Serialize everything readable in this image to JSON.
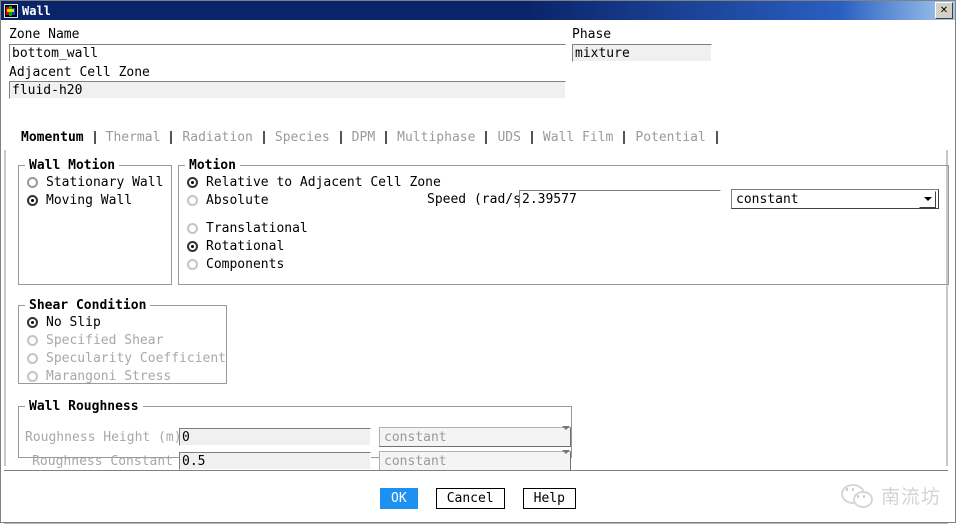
{
  "window": {
    "title": "Wall",
    "icon": "fluent-logo-icon",
    "close_label": "✕"
  },
  "form": {
    "zone_name_label": "Zone Name",
    "zone_name_value": "bottom_wall",
    "adjacent_cell_zone_label": "Adjacent Cell Zone",
    "adjacent_cell_zone_value": "fluid-h20",
    "phase_label": "Phase",
    "phase_value": "mixture"
  },
  "tabs": [
    {
      "label": "Momentum",
      "active": true
    },
    {
      "label": "Thermal",
      "active": false
    },
    {
      "label": "Radiation",
      "active": false
    },
    {
      "label": "Species",
      "active": false
    },
    {
      "label": "DPM",
      "active": false
    },
    {
      "label": "Multiphase",
      "active": false
    },
    {
      "label": "UDS",
      "active": false
    },
    {
      "label": "Wall Film",
      "active": false
    },
    {
      "label": "Potential",
      "active": false
    }
  ],
  "wall_motion": {
    "legend": "Wall Motion",
    "options": [
      {
        "label": "Stationary Wall",
        "selected": false,
        "disabled": false
      },
      {
        "label": "Moving Wall",
        "selected": true,
        "disabled": false
      }
    ]
  },
  "motion": {
    "legend": "Motion",
    "frame_options": [
      {
        "label": "Relative to Adjacent Cell Zone",
        "selected": true,
        "disabled": false
      },
      {
        "label": "Absolute",
        "selected": false,
        "disabled": false
      }
    ],
    "type_options": [
      {
        "label": "Translational",
        "selected": false,
        "disabled": false
      },
      {
        "label": "Rotational",
        "selected": true,
        "disabled": false
      },
      {
        "label": "Components",
        "selected": false,
        "disabled": false
      }
    ],
    "speed_label": "Speed (rad/s)",
    "speed_value": "2.39577",
    "speed_profile": "constant"
  },
  "shear_condition": {
    "legend": "Shear Condition",
    "options": [
      {
        "label": "No Slip",
        "selected": true,
        "disabled": false
      },
      {
        "label": "Specified Shear",
        "selected": false,
        "disabled": true
      },
      {
        "label": "Specularity Coefficient",
        "selected": false,
        "disabled": true
      },
      {
        "label": "Marangoni Stress",
        "selected": false,
        "disabled": true
      }
    ]
  },
  "wall_roughness": {
    "legend": "Wall Roughness",
    "rows": [
      {
        "label": "Roughness Height  (m)",
        "value": "0",
        "profile": "constant"
      },
      {
        "label": "Roughness Constant",
        "value": "0.5",
        "profile": "constant"
      }
    ]
  },
  "footer": {
    "buttons": [
      {
        "label": "OK",
        "primary": true
      },
      {
        "label": "Cancel",
        "primary": false
      },
      {
        "label": "Help",
        "primary": false
      }
    ]
  },
  "watermark": {
    "text": "南流坊",
    "logo": "wechat-icon"
  },
  "colors": {
    "titlebar_start": "#0a246a",
    "titlebar_end": "#a6caf0",
    "primary_button": "#1e90f0",
    "disabled_text": "#a8a8a8",
    "group_border": "#9a9a9a"
  }
}
